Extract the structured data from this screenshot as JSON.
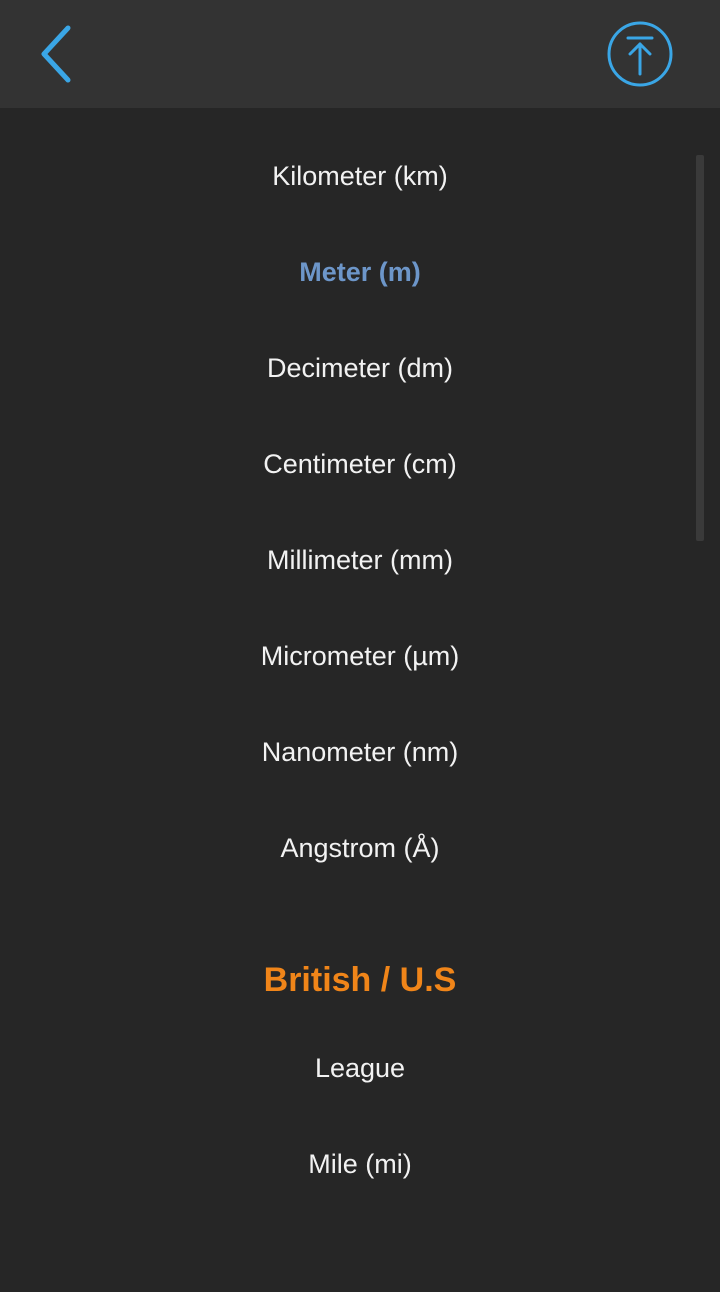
{
  "colors": {
    "background": "#262626",
    "topbar": "#333333",
    "accent_blue": "#3aa6e6",
    "selected_text": "#6d96c9",
    "section_header": "#f08519",
    "item_text": "#f2f2f2"
  },
  "header": {
    "back_icon": "chevron-left-icon",
    "top_icon": "scroll-to-top-icon"
  },
  "metric_units": [
    {
      "label": "Kilometer (km)",
      "selected": false
    },
    {
      "label": "Meter (m)",
      "selected": true
    },
    {
      "label": "Decimeter (dm)",
      "selected": false
    },
    {
      "label": "Centimeter (cm)",
      "selected": false
    },
    {
      "label": "Millimeter (mm)",
      "selected": false
    },
    {
      "label": "Micrometer (µm)",
      "selected": false
    },
    {
      "label": "Nanometer (nm)",
      "selected": false
    },
    {
      "label": "Angstrom (Å)",
      "selected": false
    }
  ],
  "british_section": {
    "title": "British / U.S",
    "units": [
      {
        "label": "League"
      },
      {
        "label": "Mile (mi)"
      }
    ]
  }
}
